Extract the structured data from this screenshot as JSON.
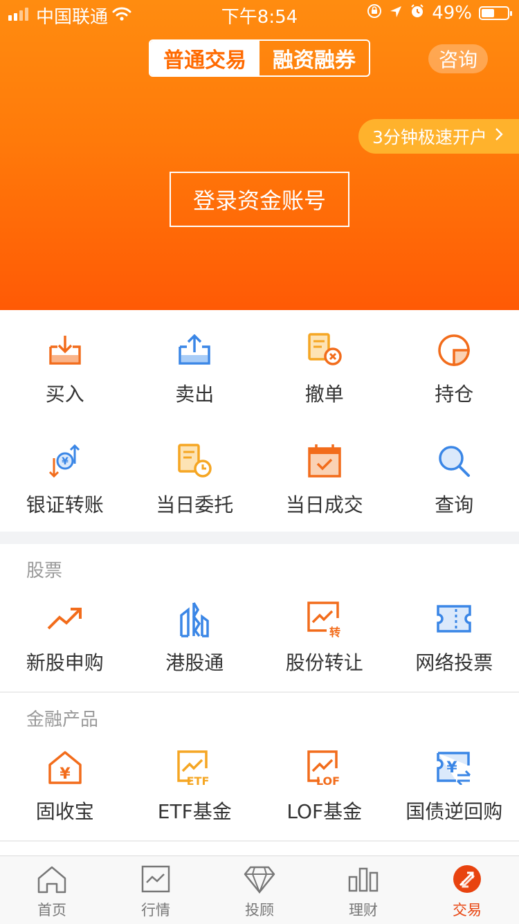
{
  "status_bar": {
    "carrier": "中国联通",
    "time": "下午8:54",
    "battery_percent": "49%",
    "battery_level": 0.49
  },
  "header": {
    "segment": [
      "普通交易",
      "融资融券"
    ],
    "consult": "咨询",
    "promo": "3分钟极速开户",
    "login_button": "登录资金账号"
  },
  "quick_actions": {
    "row1": [
      {
        "label": "买入",
        "icon": "buy-icon"
      },
      {
        "label": "卖出",
        "icon": "sell-icon"
      },
      {
        "label": "撤单",
        "icon": "cancel-order-icon"
      },
      {
        "label": "持仓",
        "icon": "position-icon"
      }
    ],
    "row2": [
      {
        "label": "银证转账",
        "icon": "bank-transfer-icon"
      },
      {
        "label": "当日委托",
        "icon": "today-orders-icon"
      },
      {
        "label": "当日成交",
        "icon": "today-deals-icon"
      },
      {
        "label": "查询",
        "icon": "search-icon"
      }
    ]
  },
  "stocks": {
    "title": "股票",
    "items": [
      {
        "label": "新股申购",
        "icon": "ipo-icon"
      },
      {
        "label": "港股通",
        "icon": "hk-connect-icon"
      },
      {
        "label": "股份转让",
        "icon": "share-transfer-icon"
      },
      {
        "label": "网络投票",
        "icon": "online-vote-icon"
      }
    ],
    "transfer_badge": "转"
  },
  "financial": {
    "title": "金融产品",
    "items": [
      {
        "label": "固收宝",
        "icon": "fixed-income-icon"
      },
      {
        "label": "ETF基金",
        "icon": "etf-icon"
      },
      {
        "label": "LOF基金",
        "icon": "lof-icon"
      },
      {
        "label": "国债逆回购",
        "icon": "treasury-repo-icon"
      }
    ],
    "etf_text": "ETF",
    "lof_text": "LOF",
    "yen": "¥"
  },
  "tabbar": [
    {
      "label": "首页",
      "icon": "home-icon"
    },
    {
      "label": "行情",
      "icon": "market-icon"
    },
    {
      "label": "投顾",
      "icon": "advisor-icon"
    },
    {
      "label": "理财",
      "icon": "wealth-icon"
    },
    {
      "label": "交易",
      "icon": "trade-icon",
      "active": true
    }
  ],
  "colors": {
    "brand_orange": "#ff6a00",
    "header_top": "#ff8c10",
    "header_bottom": "#ff5a05",
    "promo_bg": "#ffb22c",
    "icon_blue": "#3a86e6",
    "icon_orange": "#f26c1b",
    "icon_yellow": "#f5a623",
    "active_tab": "#e8430f"
  }
}
